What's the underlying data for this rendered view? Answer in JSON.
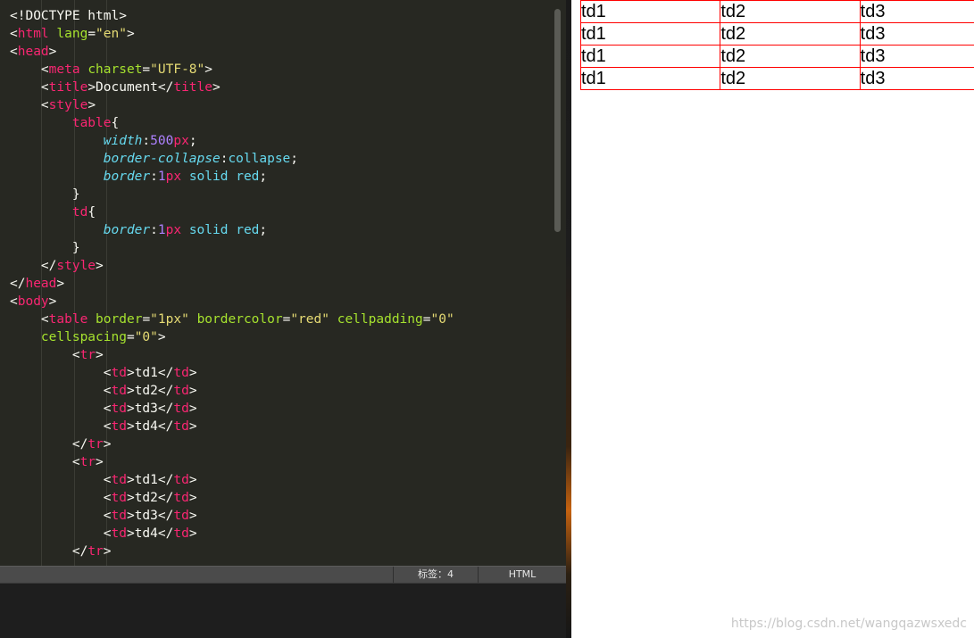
{
  "editor": {
    "lines": [
      [
        {
          "t": "<!DOCTYPE html>",
          "c": "plain"
        }
      ],
      [
        {
          "t": "<",
          "c": "plain"
        },
        {
          "t": "html",
          "c": "tag"
        },
        {
          "t": " ",
          "c": "plain"
        },
        {
          "t": "lang",
          "c": "attr"
        },
        {
          "t": "=",
          "c": "plain"
        },
        {
          "t": "\"en\"",
          "c": "str"
        },
        {
          "t": ">",
          "c": "plain"
        }
      ],
      [
        {
          "t": "<",
          "c": "plain"
        },
        {
          "t": "head",
          "c": "tag"
        },
        {
          "t": ">",
          "c": "plain"
        }
      ],
      [
        {
          "t": "    <",
          "c": "plain"
        },
        {
          "t": "meta",
          "c": "tag"
        },
        {
          "t": " ",
          "c": "plain"
        },
        {
          "t": "charset",
          "c": "attr"
        },
        {
          "t": "=",
          "c": "plain"
        },
        {
          "t": "\"UTF-8\"",
          "c": "str"
        },
        {
          "t": ">",
          "c": "plain"
        }
      ],
      [
        {
          "t": "    <",
          "c": "plain"
        },
        {
          "t": "title",
          "c": "tag"
        },
        {
          "t": ">Document</",
          "c": "plain"
        },
        {
          "t": "title",
          "c": "tag"
        },
        {
          "t": ">",
          "c": "plain"
        }
      ],
      [
        {
          "t": "    <",
          "c": "plain"
        },
        {
          "t": "style",
          "c": "tag"
        },
        {
          "t": ">",
          "c": "plain"
        }
      ],
      [
        {
          "t": "        ",
          "c": "plain"
        },
        {
          "t": "table",
          "c": "tag"
        },
        {
          "t": "{",
          "c": "plain"
        }
      ],
      [
        {
          "t": "            ",
          "c": "plain"
        },
        {
          "t": "width",
          "c": "prop"
        },
        {
          "t": ":",
          "c": "plain"
        },
        {
          "t": "500",
          "c": "num"
        },
        {
          "t": "px",
          "c": "unit"
        },
        {
          "t": ";",
          "c": "plain"
        }
      ],
      [
        {
          "t": "            ",
          "c": "plain"
        },
        {
          "t": "border-collapse",
          "c": "prop"
        },
        {
          "t": ":",
          "c": "plain"
        },
        {
          "t": "collapse",
          "c": "val"
        },
        {
          "t": ";",
          "c": "plain"
        }
      ],
      [
        {
          "t": "            ",
          "c": "plain"
        },
        {
          "t": "border",
          "c": "prop"
        },
        {
          "t": ":",
          "c": "plain"
        },
        {
          "t": "1",
          "c": "num"
        },
        {
          "t": "px",
          "c": "unit"
        },
        {
          "t": " ",
          "c": "plain"
        },
        {
          "t": "solid",
          "c": "val"
        },
        {
          "t": " ",
          "c": "plain"
        },
        {
          "t": "red",
          "c": "val"
        },
        {
          "t": ";",
          "c": "plain"
        }
      ],
      [
        {
          "t": "        }",
          "c": "plain"
        }
      ],
      [
        {
          "t": "        ",
          "c": "plain"
        },
        {
          "t": "td",
          "c": "tag"
        },
        {
          "t": "{",
          "c": "plain"
        }
      ],
      [
        {
          "t": "            ",
          "c": "plain"
        },
        {
          "t": "border",
          "c": "prop"
        },
        {
          "t": ":",
          "c": "plain"
        },
        {
          "t": "1",
          "c": "num"
        },
        {
          "t": "px",
          "c": "unit"
        },
        {
          "t": " ",
          "c": "plain"
        },
        {
          "t": "solid",
          "c": "val"
        },
        {
          "t": " ",
          "c": "plain"
        },
        {
          "t": "red",
          "c": "val"
        },
        {
          "t": ";",
          "c": "plain"
        }
      ],
      [
        {
          "t": "        }",
          "c": "plain"
        }
      ],
      [
        {
          "t": "    </",
          "c": "plain"
        },
        {
          "t": "style",
          "c": "tag"
        },
        {
          "t": ">",
          "c": "plain"
        }
      ],
      [
        {
          "t": "</",
          "c": "plain"
        },
        {
          "t": "head",
          "c": "tag"
        },
        {
          "t": ">",
          "c": "plain"
        }
      ],
      [
        {
          "t": "<",
          "c": "plain"
        },
        {
          "t": "body",
          "c": "tag"
        },
        {
          "t": ">",
          "c": "plain"
        }
      ],
      [
        {
          "t": "    <",
          "c": "plain"
        },
        {
          "t": "table",
          "c": "tag"
        },
        {
          "t": " ",
          "c": "plain"
        },
        {
          "t": "border",
          "c": "attr"
        },
        {
          "t": "=",
          "c": "plain"
        },
        {
          "t": "\"1px\"",
          "c": "str"
        },
        {
          "t": " ",
          "c": "plain"
        },
        {
          "t": "bordercolor",
          "c": "attr"
        },
        {
          "t": "=",
          "c": "plain"
        },
        {
          "t": "\"red\"",
          "c": "str"
        },
        {
          "t": " ",
          "c": "plain"
        },
        {
          "t": "cellpadding",
          "c": "attr"
        },
        {
          "t": "=",
          "c": "plain"
        },
        {
          "t": "\"0\"",
          "c": "str"
        }
      ],
      [
        {
          "t": "    ",
          "c": "plain"
        },
        {
          "t": "cellspacing",
          "c": "attr"
        },
        {
          "t": "=",
          "c": "plain"
        },
        {
          "t": "\"0\"",
          "c": "str"
        },
        {
          "t": ">",
          "c": "plain"
        }
      ],
      [
        {
          "t": "        <",
          "c": "plain"
        },
        {
          "t": "tr",
          "c": "tag"
        },
        {
          "t": ">",
          "c": "plain"
        }
      ],
      [
        {
          "t": "            <",
          "c": "plain"
        },
        {
          "t": "td",
          "c": "tag"
        },
        {
          "t": ">td1</",
          "c": "plain"
        },
        {
          "t": "td",
          "c": "tag"
        },
        {
          "t": ">",
          "c": "plain"
        }
      ],
      [
        {
          "t": "            <",
          "c": "plain"
        },
        {
          "t": "td",
          "c": "tag"
        },
        {
          "t": ">td2</",
          "c": "plain"
        },
        {
          "t": "td",
          "c": "tag"
        },
        {
          "t": ">",
          "c": "plain"
        }
      ],
      [
        {
          "t": "            <",
          "c": "plain"
        },
        {
          "t": "td",
          "c": "tag"
        },
        {
          "t": ">td3</",
          "c": "plain"
        },
        {
          "t": "td",
          "c": "tag"
        },
        {
          "t": ">",
          "c": "plain"
        }
      ],
      [
        {
          "t": "            <",
          "c": "plain"
        },
        {
          "t": "td",
          "c": "tag"
        },
        {
          "t": ">td4</",
          "c": "plain"
        },
        {
          "t": "td",
          "c": "tag"
        },
        {
          "t": ">",
          "c": "plain"
        }
      ],
      [
        {
          "t": "        </",
          "c": "plain"
        },
        {
          "t": "tr",
          "c": "tag"
        },
        {
          "t": ">",
          "c": "plain"
        }
      ],
      [
        {
          "t": "        <",
          "c": "plain"
        },
        {
          "t": "tr",
          "c": "tag"
        },
        {
          "t": ">",
          "c": "plain"
        }
      ],
      [
        {
          "t": "            <",
          "c": "plain"
        },
        {
          "t": "td",
          "c": "tag"
        },
        {
          "t": ">td1</",
          "c": "plain"
        },
        {
          "t": "td",
          "c": "tag"
        },
        {
          "t": ">",
          "c": "plain"
        }
      ],
      [
        {
          "t": "            <",
          "c": "plain"
        },
        {
          "t": "td",
          "c": "tag"
        },
        {
          "t": ">td2</",
          "c": "plain"
        },
        {
          "t": "td",
          "c": "tag"
        },
        {
          "t": ">",
          "c": "plain"
        }
      ],
      [
        {
          "t": "            <",
          "c": "plain"
        },
        {
          "t": "td",
          "c": "tag"
        },
        {
          "t": ">td3</",
          "c": "plain"
        },
        {
          "t": "td",
          "c": "tag"
        },
        {
          "t": ">",
          "c": "plain"
        }
      ],
      [
        {
          "t": "            <",
          "c": "plain"
        },
        {
          "t": "td",
          "c": "tag"
        },
        {
          "t": ">td4</",
          "c": "plain"
        },
        {
          "t": "td",
          "c": "tag"
        },
        {
          "t": ">",
          "c": "plain"
        }
      ],
      [
        {
          "t": "        </",
          "c": "plain"
        },
        {
          "t": "tr",
          "c": "tag"
        },
        {
          "t": ">",
          "c": "plain"
        }
      ]
    ]
  },
  "statusbar": {
    "tab_size": "标签：4",
    "syntax": "HTML"
  },
  "preview": {
    "rows": [
      [
        "td1",
        "td2",
        "td3"
      ],
      [
        "td1",
        "td2",
        "td3"
      ],
      [
        "td1",
        "td2",
        "td3"
      ],
      [
        "td1",
        "td2",
        "td3"
      ]
    ]
  },
  "watermark": "https://blog.csdn.net/wangqazwsxedc",
  "colors": {
    "editor_bg": "#272822",
    "tag": "#f92672",
    "attr": "#a6e22e",
    "string": "#e6db74",
    "property": "#66d9ef",
    "number": "#ae81ff",
    "table_border": "red"
  }
}
